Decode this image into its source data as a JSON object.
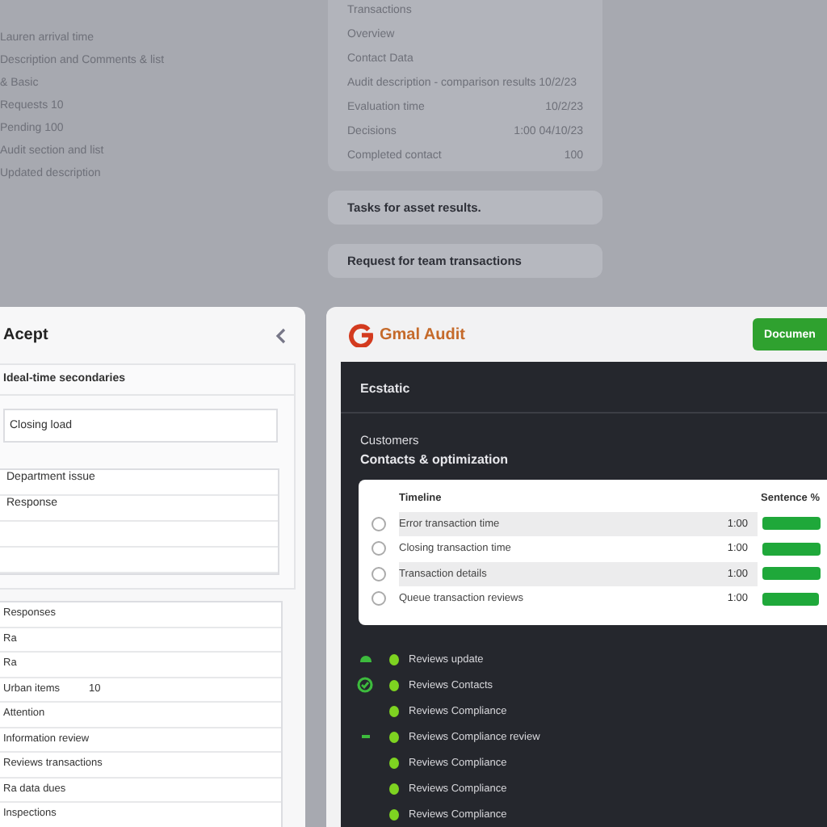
{
  "background": {
    "left_list": [
      "Lauren arrival time",
      "Description and Comments & list",
      "& Basic",
      "Requests 10",
      "Pending 100",
      "Audit section and list",
      "Updated description"
    ],
    "center_card": {
      "rows": [
        {
          "label": "Transactions"
        },
        {
          "label": "Overview"
        },
        {
          "label": "Contact Data"
        },
        {
          "label": "Audit description - comparison results 10/2/23"
        },
        {
          "label": "Evaluation time",
          "value": "10/2/23"
        },
        {
          "label": "Decisions",
          "value": "1:00   04/10/23"
        },
        {
          "label": "Completed contact",
          "value": "100"
        }
      ]
    },
    "cards": [
      "Tasks for asset results.",
      "Request for team transactions"
    ]
  },
  "left_panel": {
    "title": "Acept",
    "section_title": "Ideal-time secondaries",
    "field": {
      "value": "Closing load"
    },
    "list_a": [
      "Department issue",
      "Response"
    ],
    "list_b": [
      {
        "label": "Responses"
      },
      {
        "label": "Ra"
      },
      {
        "label": "Ra"
      },
      {
        "label": "Urban items",
        "value": "10"
      },
      {
        "label": "Attention"
      },
      {
        "label": "Information review"
      },
      {
        "label": "Reviews transactions"
      },
      {
        "label": "Ra data dues"
      },
      {
        "label": "Inspections"
      }
    ]
  },
  "header": {
    "app_name": "Gmal Audit",
    "button": "Documen"
  },
  "main": {
    "section": "Ecstatic",
    "subtitle": "Customers",
    "title": "Contacts & optimization",
    "table": {
      "columns": [
        "Timeline",
        "Sentence %"
      ],
      "rows": [
        {
          "label": "Error transaction time",
          "value": "1:00",
          "level": 0.9,
          "selected": false
        },
        {
          "label": "Closing transaction time",
          "value": "1:00",
          "level": 0.9,
          "selected": false
        },
        {
          "label": "Transaction details",
          "value": "1:00",
          "level": 0.9,
          "selected": false
        },
        {
          "label": "Queue transaction reviews",
          "value": "1:00",
          "level": 0.88,
          "selected": false
        }
      ]
    },
    "items": [
      {
        "label": "Reviews update",
        "kind": "partial"
      },
      {
        "label": "Reviews Contacts",
        "kind": "done"
      },
      {
        "label": "Reviews Compliance",
        "kind": "plain"
      },
      {
        "label": "Reviews Compliance review",
        "kind": "pending"
      },
      {
        "label": "Reviews Compliance",
        "kind": "plain"
      },
      {
        "label": "Reviews Compliance",
        "kind": "plain"
      },
      {
        "label": "Reviews Compliance",
        "kind": "plain"
      }
    ]
  }
}
